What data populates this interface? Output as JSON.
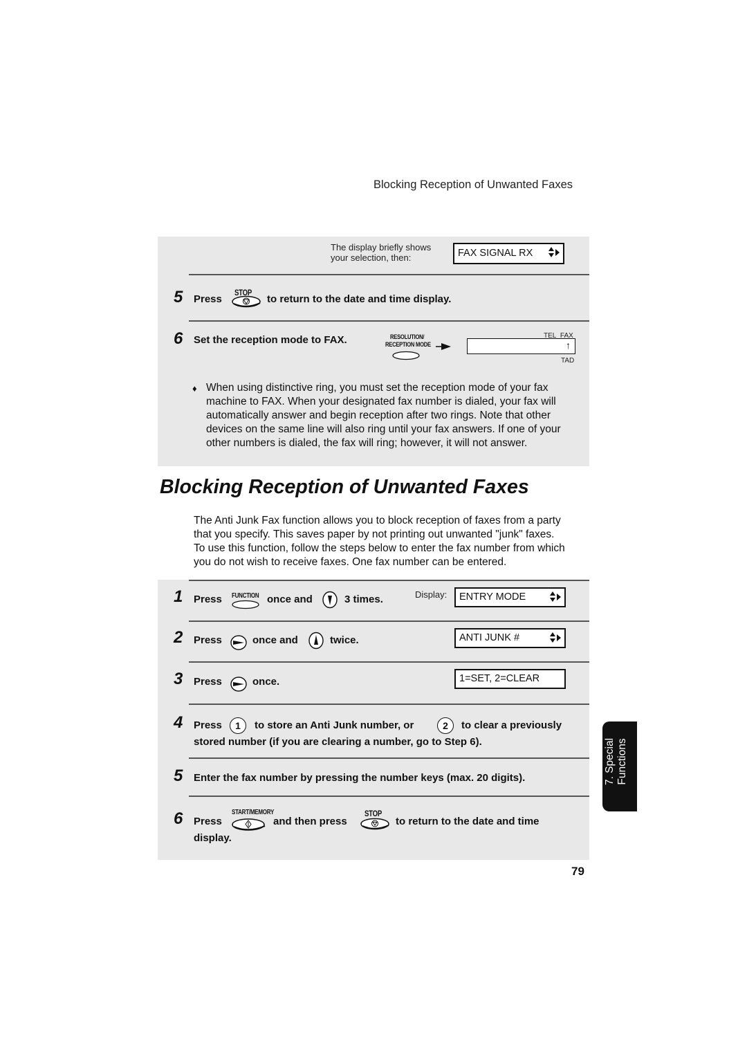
{
  "running_header": "Blocking Reception of Unwanted Faxes",
  "section_prev": {
    "display_note_line1": "The display briefly shows",
    "display_note_line2": "your selection, then:",
    "display_value": "FAX SIGNAL RX",
    "steps": [
      {
        "number": "5",
        "press": "Press",
        "key_label": "STOP",
        "text": "to return to the date and time display."
      },
      {
        "number": "6",
        "text": "Set the reception mode to FAX.",
        "key_label_line1": "RESOLUTION/",
        "key_label_line2": "RECEPTION MODE",
        "mode_labels": {
          "tel": "TEL",
          "fax": "FAX",
          "tad": "TAD"
        }
      }
    ],
    "note_bullet": "♦",
    "note_lines": [
      "When using distinctive ring, you must set the reception mode of your fax",
      "machine to FAX. When your designated fax number is dialed, your fax will",
      "automatically answer and begin reception after two rings. Note that other",
      "devices on the same line will also ring until your fax answers. If one of your",
      "other numbers is dialed, the fax will ring; however, it will not answer."
    ]
  },
  "section": {
    "title": "Blocking Reception of Unwanted Faxes",
    "intro_lines": [
      "The Anti Junk Fax function allows you to block reception of faxes from a party",
      "that you specify. This saves paper by not printing out unwanted \"junk\" faxes.",
      "To use this function, follow the steps below to enter the fax number from which",
      "you do not wish to receive faxes. One fax number can be entered."
    ],
    "display_label": "Display:",
    "steps": [
      {
        "number": "1",
        "press": "Press",
        "key_label": "FUNCTION",
        "mid": "once and",
        "end": "3 times.",
        "display": "ENTRY MODE"
      },
      {
        "number": "2",
        "press": "Press",
        "mid": "once and",
        "end": "twice.",
        "display": "ANTI JUNK #"
      },
      {
        "number": "3",
        "press": "Press",
        "end": "once.",
        "display": "1=SET, 2=CLEAR"
      },
      {
        "number": "4",
        "press": "Press",
        "key1": "1",
        "mid": "to store an Anti Junk number, or",
        "key2": "2",
        "end": "to clear a previously",
        "line2": "stored number (if you are clearing a number, go to Step 6)."
      },
      {
        "number": "5",
        "text": "Enter the fax number by pressing the number keys (max. 20 digits)."
      },
      {
        "number": "6",
        "press": "Press",
        "key_label": "START/MEMORY",
        "mid": "and then press",
        "key2_label": "STOP",
        "end": "to return to the date and time",
        "line2": "display."
      }
    ]
  },
  "side_tab": {
    "line1": "7. Special",
    "line2": "Functions"
  },
  "page_number": "79"
}
